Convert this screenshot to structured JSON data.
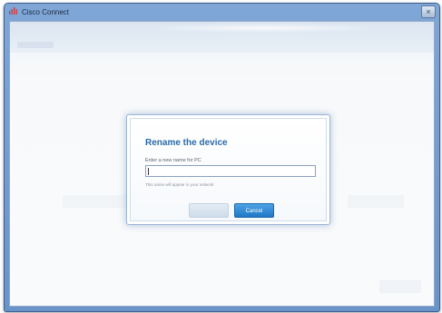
{
  "window": {
    "title": "Cisco Connect",
    "close_glyph": "×",
    "icon": "cisco-logo-icon"
  },
  "dialog": {
    "title": "Rename the device",
    "prompt": "Enter a new name for PC",
    "input_value": "",
    "hint": "This name will appear in your network",
    "ok_label": "",
    "cancel_label": "Cancel"
  },
  "colors": {
    "accent": "#1f78c6",
    "title_blue": "#2a6aa8",
    "window_frame": "#6a93c9"
  }
}
